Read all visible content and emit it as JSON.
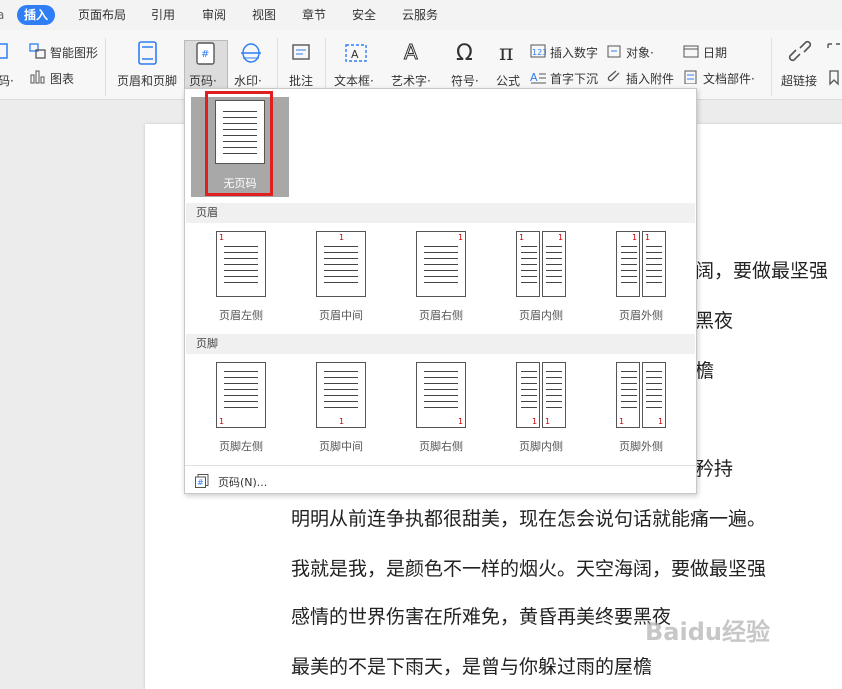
{
  "menu_tabs": [
    "插入",
    "页面布局",
    "引用",
    "审阅",
    "视图",
    "章节",
    "安全",
    "云服务"
  ],
  "ribbon": {
    "smart_shape": "智能图形",
    "chart": "图表",
    "code_frag": "码·",
    "header_footer": "页眉和页脚",
    "page_number": "页码·",
    "watermark": "水印·",
    "comment": "批注",
    "textbox": "文本框·",
    "wordart": "艺术字·",
    "symbol": "符号·",
    "formula": "公式",
    "insert_number": "插入数字",
    "object": "对象·",
    "dropcap": "首字下沉",
    "attachment": "插入附件",
    "date": "日期",
    "doc_parts": "文档部件·",
    "hyperlink": "超链接"
  },
  "dropdown": {
    "no_page_number": "无页码",
    "header_section": "页眉",
    "footer_section": "页脚",
    "header_items": [
      "页眉左侧",
      "页眉中间",
      "页眉右侧",
      "页眉内侧",
      "页眉外侧"
    ],
    "footer_items": [
      "页脚左侧",
      "页脚中间",
      "页脚右侧",
      "页脚内侧",
      "页脚外侧"
    ],
    "page_number_dialog": "页码(N)..."
  },
  "document": {
    "partial_lines": [
      "阔，要做最坚强",
      "黑夜",
      "檐",
      "矜持"
    ],
    "lines": [
      "明明从前连争执都很甜美，现在怎会说句话就能痛一遍。",
      "我就是我，是颜色不一样的烟火。天空海阔，要做最坚强",
      "感情的世界伤害在所难免，黄昏再美终要黑夜",
      "最美的不是下雨天，是曾与你躲过雨的屋檐"
    ]
  },
  "watermark_text": "Baidu经验",
  "accent": "#2f7ef5",
  "highlight_color": "#e02020"
}
